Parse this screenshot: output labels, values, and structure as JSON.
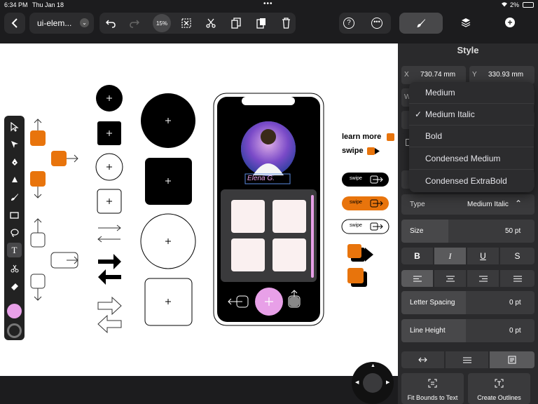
{
  "status": {
    "time": "6:34 PM",
    "date": "Thu Jan 18",
    "battery": "2%"
  },
  "toolbar": {
    "doc_title": "ui-elem...",
    "zoom": "15%"
  },
  "panel": {
    "title": "Style",
    "x_label": "X",
    "x_value": "730.74 mm",
    "y_label": "Y",
    "y_value": "330.93 mm",
    "w_label": "W",
    "type_label": "Type",
    "type_value": "Medium Italic",
    "size_label": "Size",
    "size_value": "50 pt",
    "style_b": "B",
    "style_i": "I",
    "style_u": "U",
    "style_s": "S",
    "letter_spacing_label": "Letter Spacing",
    "letter_spacing_value": "0 pt",
    "line_height_label": "Line Height",
    "line_height_value": "0 pt",
    "fit_bounds_label": "Fit Bounds to Text",
    "create_outlines_label": "Create Outlines"
  },
  "dropdown": {
    "check": "✓",
    "items": [
      "Medium",
      "Medium Italic",
      "Bold",
      "Condensed Medium",
      "Condensed ExtraBold"
    ],
    "selected": 1
  },
  "canvas": {
    "learn_more": "learn more",
    "swipe": "swipe",
    "pill1": "swipe",
    "pill2": "swipe",
    "pill3": "swipe",
    "profile_name": "Elena G."
  },
  "colors": {
    "accent": "#e8740c",
    "pink": "#e8a0e8",
    "panel": "#2a2a2c"
  }
}
